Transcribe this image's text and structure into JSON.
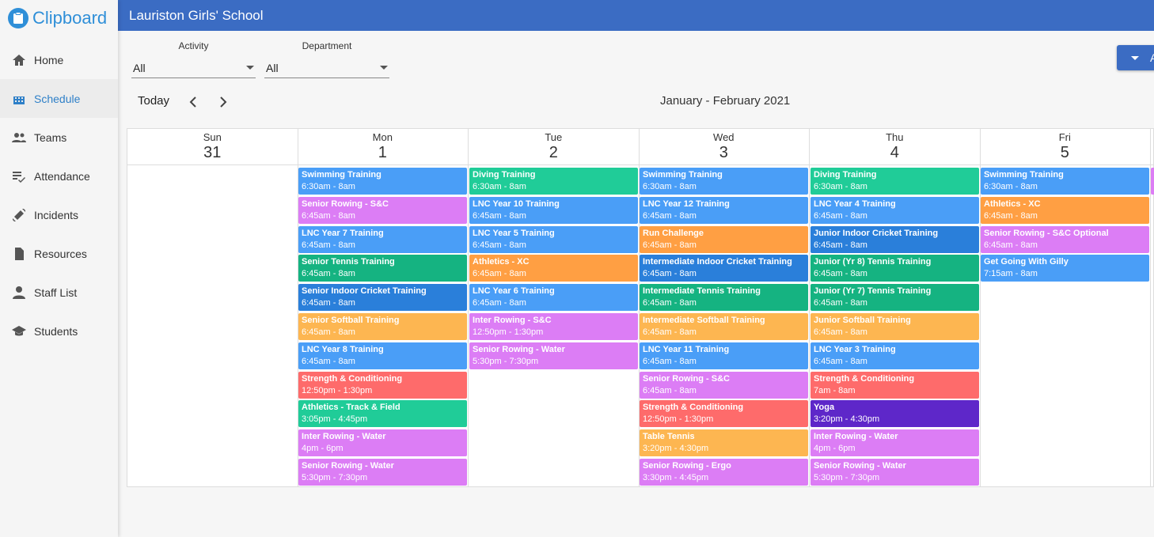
{
  "app": {
    "name": "Clipboard",
    "school": "Lauriston Girls' School"
  },
  "nav": [
    {
      "label": "Home",
      "icon": "home-icon",
      "active": false
    },
    {
      "label": "Schedule",
      "icon": "calendar-icon",
      "active": true
    },
    {
      "label": "Teams",
      "icon": "people-icon",
      "active": false
    },
    {
      "label": "Attendance",
      "icon": "checklist-icon",
      "active": false
    },
    {
      "label": "Incidents",
      "icon": "bandage-icon",
      "active": false
    },
    {
      "label": "Resources",
      "icon": "document-icon",
      "active": false
    },
    {
      "label": "Staff List",
      "icon": "person-icon",
      "active": false
    },
    {
      "label": "Students",
      "icon": "graduation-cap-icon",
      "active": false
    }
  ],
  "filters": {
    "activity": {
      "label": "Activity",
      "value": "All"
    },
    "department": {
      "label": "Department",
      "value": "All"
    }
  },
  "add_button": {
    "label": "A"
  },
  "toolbar": {
    "today_label": "Today",
    "range_title": "January - February 2021"
  },
  "colors": {
    "blue": "#4a9ef7",
    "darkblue": "#2a7fda",
    "teal": "#20cc98",
    "green": "#15b381",
    "pink": "#dc7df5",
    "orange": "#ff9f43",
    "yellow": "#fdb651",
    "red": "#fe6b6b",
    "purple": "#5e27c9"
  },
  "days": [
    {
      "name": "Sun",
      "date": "31",
      "events": []
    },
    {
      "name": "Mon",
      "date": "1",
      "events": [
        {
          "title": "Swimming Training",
          "time": "6:30am - 8am",
          "color": "blue"
        },
        {
          "title": "Senior Rowing - S&C",
          "time": "6:45am - 8am",
          "color": "pink"
        },
        {
          "title": "LNC Year 7 Training",
          "time": "6:45am - 8am",
          "color": "blue"
        },
        {
          "title": "Senior Tennis Training",
          "time": "6:45am - 8am",
          "color": "green"
        },
        {
          "title": "Senior Indoor Cricket Training",
          "time": "6:45am - 8am",
          "color": "darkblue"
        },
        {
          "title": "Senior Softball Training",
          "time": "6:45am - 8am",
          "color": "yellow"
        },
        {
          "title": "LNC Year 8 Training",
          "time": "6:45am - 8am",
          "color": "blue"
        },
        {
          "title": "Strength & Conditioning",
          "time": "12:50pm - 1:30pm",
          "color": "red"
        },
        {
          "title": "Athletics - Track & Field",
          "time": "3:05pm - 4:45pm",
          "color": "teal"
        },
        {
          "title": "Inter Rowing - Water",
          "time": "4pm - 6pm",
          "color": "pink"
        },
        {
          "title": "Senior Rowing - Water",
          "time": "5:30pm - 7:30pm",
          "color": "pink"
        }
      ]
    },
    {
      "name": "Tue",
      "date": "2",
      "events": [
        {
          "title": "Diving Training",
          "time": "6:30am - 8am",
          "color": "teal"
        },
        {
          "title": "LNC Year 10 Training",
          "time": "6:45am - 8am",
          "color": "blue"
        },
        {
          "title": "LNC Year 5 Training",
          "time": "6:45am - 8am",
          "color": "blue"
        },
        {
          "title": "Athletics - XC",
          "time": "6:45am - 8am",
          "color": "orange"
        },
        {
          "title": "LNC Year 6 Training",
          "time": "6:45am - 8am",
          "color": "blue"
        },
        {
          "title": "Inter Rowing - S&C",
          "time": "12:50pm - 1:30pm",
          "color": "pink"
        },
        {
          "title": "Senior Rowing - Water",
          "time": "5:30pm - 7:30pm",
          "color": "pink"
        }
      ]
    },
    {
      "name": "Wed",
      "date": "3",
      "events": [
        {
          "title": "Swimming Training",
          "time": "6:30am - 8am",
          "color": "blue"
        },
        {
          "title": "LNC Year 12 Training",
          "time": "6:45am - 8am",
          "color": "blue"
        },
        {
          "title": "Run Challenge",
          "time": "6:45am - 8am",
          "color": "orange"
        },
        {
          "title": "Intermediate Indoor Cricket Training",
          "time": "6:45am - 8am",
          "color": "darkblue"
        },
        {
          "title": "Intermediate Tennis Training",
          "time": "6:45am - 8am",
          "color": "green"
        },
        {
          "title": "Intermediate Softball Training",
          "time": "6:45am - 8am",
          "color": "yellow"
        },
        {
          "title": "LNC Year 11 Training",
          "time": "6:45am - 8am",
          "color": "blue"
        },
        {
          "title": "Senior Rowing - S&C",
          "time": "6:45am - 8am",
          "color": "pink"
        },
        {
          "title": "Strength & Conditioning",
          "time": "12:50pm - 1:30pm",
          "color": "red"
        },
        {
          "title": "Table Tennis",
          "time": "3:20pm - 4:30pm",
          "color": "yellow"
        },
        {
          "title": "Senior Rowing - Ergo",
          "time": "3:30pm - 4:45pm",
          "color": "pink"
        }
      ]
    },
    {
      "name": "Thu",
      "date": "4",
      "events": [
        {
          "title": "Diving Training",
          "time": "6:30am - 8am",
          "color": "teal"
        },
        {
          "title": "LNC Year 4 Training",
          "time": "6:45am - 8am",
          "color": "blue"
        },
        {
          "title": "Junior Indoor Cricket Training",
          "time": "6:45am - 8am",
          "color": "darkblue"
        },
        {
          "title": "Junior (Yr 8) Tennis Training",
          "time": "6:45am - 8am",
          "color": "green"
        },
        {
          "title": "Junior (Yr 7) Tennis Training",
          "time": "6:45am - 8am",
          "color": "green"
        },
        {
          "title": "Junior Softball Training",
          "time": "6:45am - 8am",
          "color": "yellow"
        },
        {
          "title": "LNC Year 3 Training",
          "time": "6:45am - 8am",
          "color": "blue"
        },
        {
          "title": "Strength & Conditioning",
          "time": "7am - 8am",
          "color": "red"
        },
        {
          "title": "Yoga",
          "time": "3:20pm - 4:30pm",
          "color": "purple"
        },
        {
          "title": "Inter Rowing - Water",
          "time": "4pm - 6pm",
          "color": "pink"
        },
        {
          "title": "Senior Rowing - Water",
          "time": "5:30pm - 7:30pm",
          "color": "pink"
        }
      ]
    },
    {
      "name": "Fri",
      "date": "5",
      "events": [
        {
          "title": "Swimming Training",
          "time": "6:30am - 8am",
          "color": "blue"
        },
        {
          "title": "Athletics - XC",
          "time": "6:45am - 8am",
          "color": "orange"
        },
        {
          "title": "Senior Rowing - S&C Optional",
          "time": "6:45am - 8am",
          "color": "pink"
        },
        {
          "title": "Get Going With Gilly",
          "time": "7:15am - 8am",
          "color": "blue"
        }
      ]
    }
  ]
}
